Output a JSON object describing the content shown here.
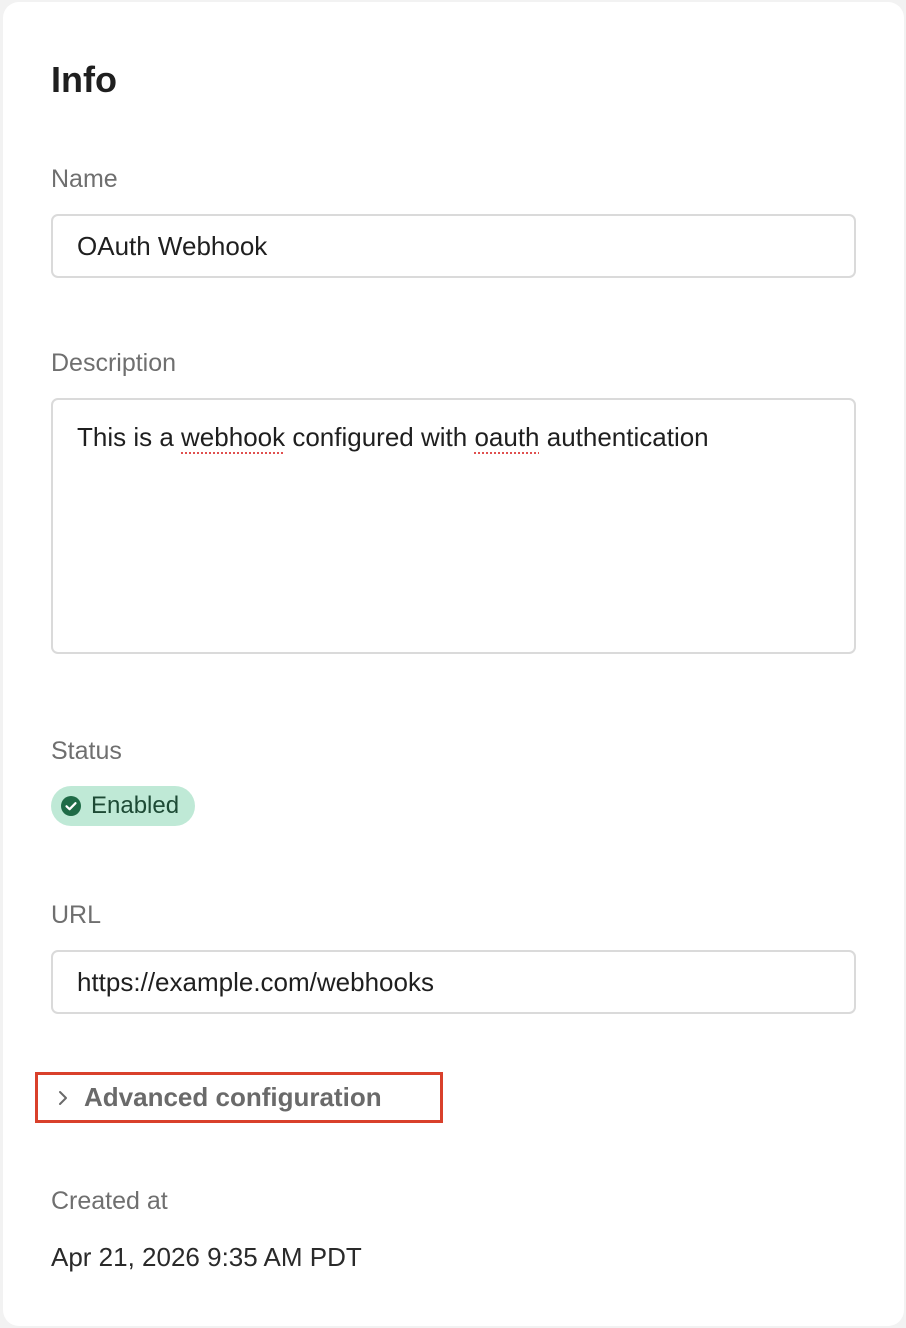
{
  "info": {
    "title": "Info"
  },
  "name_field": {
    "label": "Name",
    "value": "OAuth Webhook"
  },
  "description_field": {
    "label": "Description",
    "value_parts": [
      "This is a ",
      "webhook",
      " configured with ",
      "oauth",
      " authentication"
    ]
  },
  "status": {
    "label": "Status",
    "badge": "Enabled",
    "icon": "check-circle-icon",
    "badge_bg": "#bfe9d6",
    "badge_text_color": "#1d4a35"
  },
  "url_field": {
    "label": "URL",
    "value": "https://example.com/webhooks"
  },
  "advanced": {
    "label": "Advanced configuration",
    "icon": "chevron-right-icon",
    "highlight_color": "#d9402b"
  },
  "created": {
    "label": "Created at",
    "value": "Apr 21, 2026 9:35 AM PDT"
  }
}
